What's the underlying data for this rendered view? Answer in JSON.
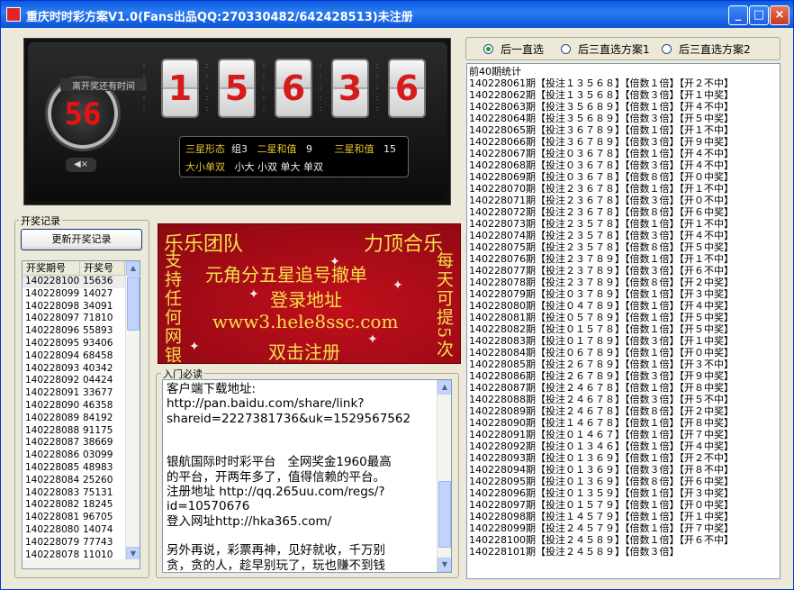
{
  "window": {
    "title": "重庆时时彩方案V1.0(Fans出品QQ:270330482/642428513)未注册",
    "minimize": "_",
    "maximize": "□",
    "close": "×"
  },
  "lottery": {
    "countdown_label": "离开奖还有时间",
    "countdown": "56",
    "digits": [
      "1",
      "5",
      "6",
      "3",
      "6"
    ],
    "mute_icon": "◀×",
    "row1": {
      "shape_label": "三星形态",
      "shape_value": "组3",
      "sum2_label": "二星和值",
      "sum2_value": "9",
      "sum3_label": "三星和值",
      "sum3_value": "15"
    },
    "row2": {
      "bigsmall_label": "大小单双",
      "values": "小大  小双  单大  单双"
    }
  },
  "history": {
    "group_label": "开奖记录",
    "refresh_button": "更新开奖记录",
    "columns": [
      "开奖期号",
      "开奖号"
    ],
    "rows": [
      [
        "140228100",
        "15636"
      ],
      [
        "140228099",
        "14027"
      ],
      [
        "140228098",
        "34091"
      ],
      [
        "140228097",
        "71810"
      ],
      [
        "140228096",
        "55893"
      ],
      [
        "140228095",
        "93406"
      ],
      [
        "140228094",
        "68458"
      ],
      [
        "140228093",
        "40342"
      ],
      [
        "140228092",
        "04424"
      ],
      [
        "140228091",
        "33677"
      ],
      [
        "140228090",
        "46358"
      ],
      [
        "140228089",
        "84192"
      ],
      [
        "140228088",
        "91175"
      ],
      [
        "140228087",
        "38669"
      ],
      [
        "140228086",
        "03099"
      ],
      [
        "140228085",
        "48983"
      ],
      [
        "140228084",
        "25260"
      ],
      [
        "140228083",
        "75131"
      ],
      [
        "140228082",
        "18245"
      ],
      [
        "140228081",
        "96705"
      ],
      [
        "140228080",
        "14074"
      ],
      [
        "140228079",
        "77743"
      ],
      [
        "140228078",
        "11010"
      ]
    ]
  },
  "banner": {
    "team": "乐乐团队",
    "slogan": "力顶合乐",
    "left_vertical": "支持任何网银",
    "right_vertical": "每天可提5次",
    "line1": "元角分五星追号撤单",
    "line2": "登录地址",
    "line3": "www3.hele8ssc.com",
    "line4": "双击注册"
  },
  "guide": {
    "group_label": "入门必读",
    "text": "客户端下载地址:\nhttp://pan.baidu.com/share/link?\nshareid=2227381736&uk=1529567562\n\n\n银航国际时时彩平台   全网奖金1960最高\n的平台，开两年多了，值得信赖的平台。\n注册地址 http://qq.265uu.com/regs/?\nid=10570676\n登入网址http://hka365.com/\n\n另外再说，彩票再神，见好就收，千万别\n贪，贪的人，趁早别玩了，玩也赚不到钱"
  },
  "options": {
    "radio1": "后一直选",
    "radio2": "后三直选方案1",
    "radio3": "后三直选方案2",
    "selected": 1
  },
  "stats": {
    "header": "前40期统计",
    "lines": [
      "140228061期【投注１３５６８】【倍数１倍】【开２不中】",
      "140228062期【投注１３５６８】【倍数３倍】【开１中奖】",
      "140228063期【投注３５６８９】【倍数１倍】【开４不中】",
      "140228064期【投注３５６８９】【倍数３倍】【开５中奖】",
      "140228065期【投注３６７８９】【倍数１倍】【开１不中】",
      "140228066期【投注３６７８９】【倍数３倍】【开９中奖】",
      "140228067期【投注０３６７８】【倍数１倍】【开４不中】",
      "140228068期【投注０３６７８】【倍数３倍】【开４不中】",
      "140228069期【投注０３６７８】【倍数８倍】【开０中奖】",
      "140228070期【投注２３６７８】【倍数１倍】【开１不中】",
      "140228071期【投注２３６７８】【倍数３倍】【开０不中】",
      "140228072期【投注２３６７８】【倍数８倍】【开６中奖】",
      "140228073期【投注２３５７８】【倍数１倍】【开１不中】",
      "140228074期【投注２３５７８】【倍数３倍】【开４不中】",
      "140228075期【投注２３５７８】【倍数８倍】【开５中奖】",
      "140228076期【投注２３７８９】【倍数１倍】【开１不中】",
      "140228077期【投注２３７８９】【倍数３倍】【开６不中】",
      "140228078期【投注２３７８９】【倍数８倍】【开２中奖】",
      "140228079期【投注０３７８９】【倍数１倍】【开３中奖】",
      "140228080期【投注０４７８９】【倍数１倍】【开４中奖】",
      "140228081期【投注０５７８９】【倍数１倍】【开５中奖】",
      "140228082期【投注０１５７８】【倍数１倍】【开５中奖】",
      "140228083期【投注０１７８９】【倍数３倍】【开１中奖】",
      "140228084期【投注０６７８９】【倍数１倍】【开０中奖】",
      "140228085期【投注２６７８９】【倍数１倍】【开３不中】",
      "140228086期【投注２６７８９】【倍数３倍】【开９中奖】",
      "140228087期【投注２４６７８】【倍数１倍】【开８中奖】",
      "140228088期【投注２４６７８】【倍数３倍】【开５不中】",
      "140228089期【投注２４６７８】【倍数８倍】【开２中奖】",
      "140228090期【投注１４６７８】【倍数１倍】【开８中奖】",
      "140228091期【投注０１４６７】【倍数１倍】【开７中奖】",
      "140228092期【投注０１３４６】【倍数１倍】【开４中奖】",
      "140228093期【投注０１３６９】【倍数１倍】【开２不中】",
      "140228094期【投注０１３６９】【倍数３倍】【开８不中】",
      "140228095期【投注０１３６９】【倍数８倍】【开６中奖】",
      "140228096期【投注０１３５９】【倍数１倍】【开３中奖】",
      "140228097期【投注０１５７９】【倍数１倍】【开０中奖】",
      "140228098期【投注１４５７９】【倍数１倍】【开１中奖】",
      "140228099期【投注２４５７９】【倍数１倍】【开７中奖】",
      "140228100期【投注２４５８９】【倍数１倍】【开６不中】",
      "140228101期【投注２４５８９】【倍数３倍】"
    ]
  }
}
